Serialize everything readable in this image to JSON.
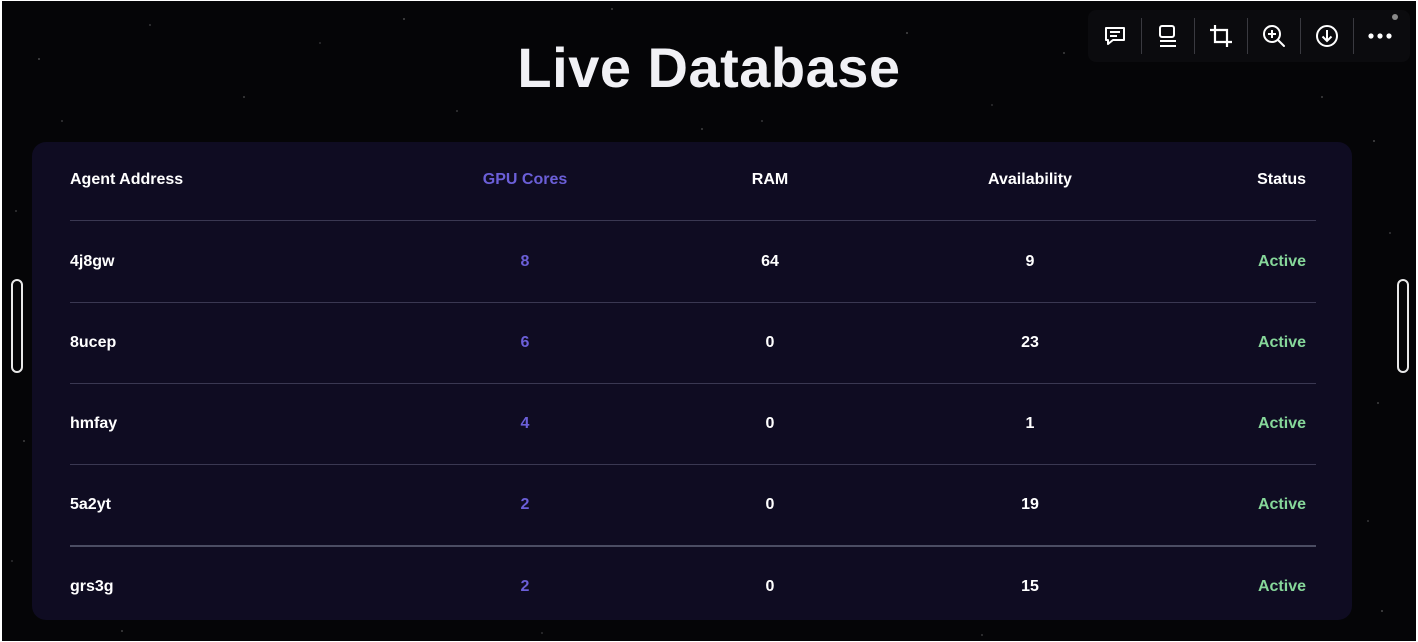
{
  "page": {
    "title": "Live Database"
  },
  "toolbar": {
    "buttons": [
      {
        "name": "comment",
        "icon": "comment-icon"
      },
      {
        "name": "caption",
        "icon": "caption-icon"
      },
      {
        "name": "crop",
        "icon": "crop-icon"
      },
      {
        "name": "zoom",
        "icon": "zoom-in-icon"
      },
      {
        "name": "download",
        "icon": "download-icon"
      },
      {
        "name": "more",
        "icon": "more-icon"
      }
    ]
  },
  "table": {
    "columns": [
      "Agent Address",
      "GPU Cores",
      "RAM",
      "Availability",
      "Status"
    ],
    "rows": [
      {
        "address": "4j8gw",
        "gpu": "8",
        "ram": "64",
        "availability": "9",
        "status": "Active"
      },
      {
        "address": "8ucep",
        "gpu": "6",
        "ram": "0",
        "availability": "23",
        "status": "Active"
      },
      {
        "address": "hmfay",
        "gpu": "4",
        "ram": "0",
        "availability": "1",
        "status": "Active"
      },
      {
        "address": "5a2yt",
        "gpu": "2",
        "ram": "0",
        "availability": "19",
        "status": "Active"
      },
      {
        "address": "grs3g",
        "gpu": "2",
        "ram": "0",
        "availability": "15",
        "status": "Active"
      }
    ]
  },
  "colors": {
    "background": "#050507",
    "card": "#0f0c22",
    "accent": "#6b5fd8",
    "status_active": "#86d79a"
  }
}
